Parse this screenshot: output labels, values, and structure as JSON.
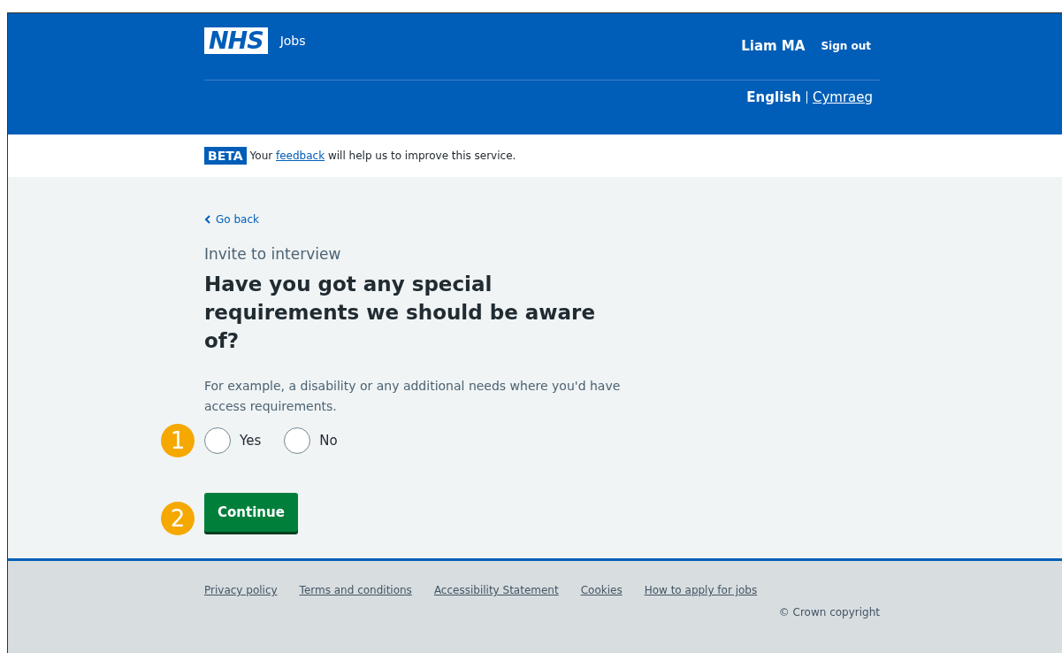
{
  "header": {
    "logo": "NHS",
    "service": "Jobs",
    "user": "Liam MA",
    "sign_out": "Sign out",
    "languages": [
      {
        "label": "English",
        "selected": true
      },
      {
        "label": "Cymraeg",
        "selected": false
      }
    ]
  },
  "banner": {
    "tag": "BETA",
    "before": "Your",
    "link": "feedback",
    "after": "will help us to improve this service."
  },
  "back_link": "Go back",
  "caption": "Invite to interview",
  "heading": "Have you got any special requirements we should be aware of?",
  "hint": "For example, a disability or any additional needs where you'd have access requirements.",
  "options": [
    {
      "label": "Yes",
      "selected": false
    },
    {
      "label": "No",
      "selected": false
    }
  ],
  "button": "Continue",
  "callouts": [
    "1",
    "2"
  ],
  "footer": {
    "links": [
      "Privacy policy",
      "Terms and conditions",
      "Accessibility Statement",
      "Cookies",
      "How to apply for jobs"
    ],
    "copyright": "© Crown copyright"
  }
}
